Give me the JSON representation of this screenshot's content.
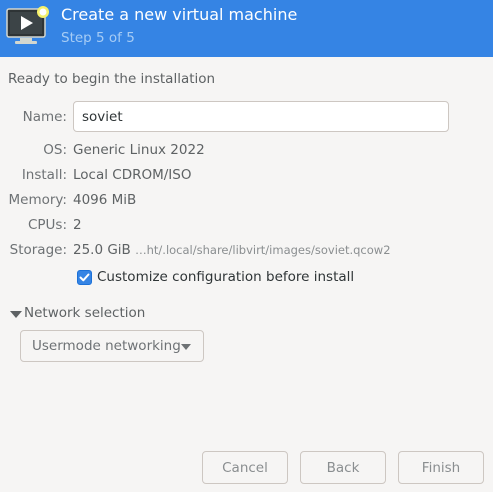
{
  "header": {
    "title": "Create a new virtual machine",
    "step": "Step 5 of 5",
    "icon": "vm-create-icon",
    "color": "#3584e4"
  },
  "ready_text": "Ready to begin the installation",
  "fields": {
    "name": {
      "label": "Name:",
      "value": "soviet"
    },
    "os": {
      "label": "OS:",
      "value": "Generic Linux 2022"
    },
    "install": {
      "label": "Install:",
      "value": "Local CDROM/ISO"
    },
    "memory": {
      "label": "Memory:",
      "value": "4096 MiB"
    },
    "cpus": {
      "label": "CPUs:",
      "value": "2"
    },
    "storage": {
      "label": "Storage:",
      "value": "25.0 GiB",
      "path": "…ht/.local/share/libvirt/images/soviet.qcow2"
    }
  },
  "customize": {
    "label": "Customize configuration before install",
    "checked": true
  },
  "network": {
    "expander_label": "Network selection",
    "selected": "Usermode networking"
  },
  "buttons": {
    "cancel": "Cancel",
    "back": "Back",
    "finish": "Finish"
  }
}
